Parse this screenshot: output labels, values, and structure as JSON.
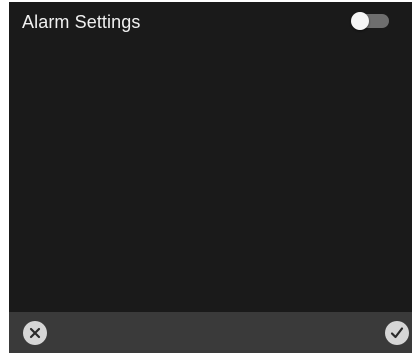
{
  "header": {
    "title": "Alarm Settings",
    "toggle": {
      "state": "off"
    }
  },
  "footer": {
    "cancel_icon": "close-icon",
    "confirm_icon": "check-icon"
  },
  "colors": {
    "background": "#1a1a1a",
    "footer": "#3a3a3a",
    "title_text": "#f0f0f0",
    "toggle_track": "#6e6e6e",
    "toggle_thumb": "#f5f5f5",
    "button_fill": "#d6d6d6",
    "button_glyph": "#2a2a2a"
  }
}
